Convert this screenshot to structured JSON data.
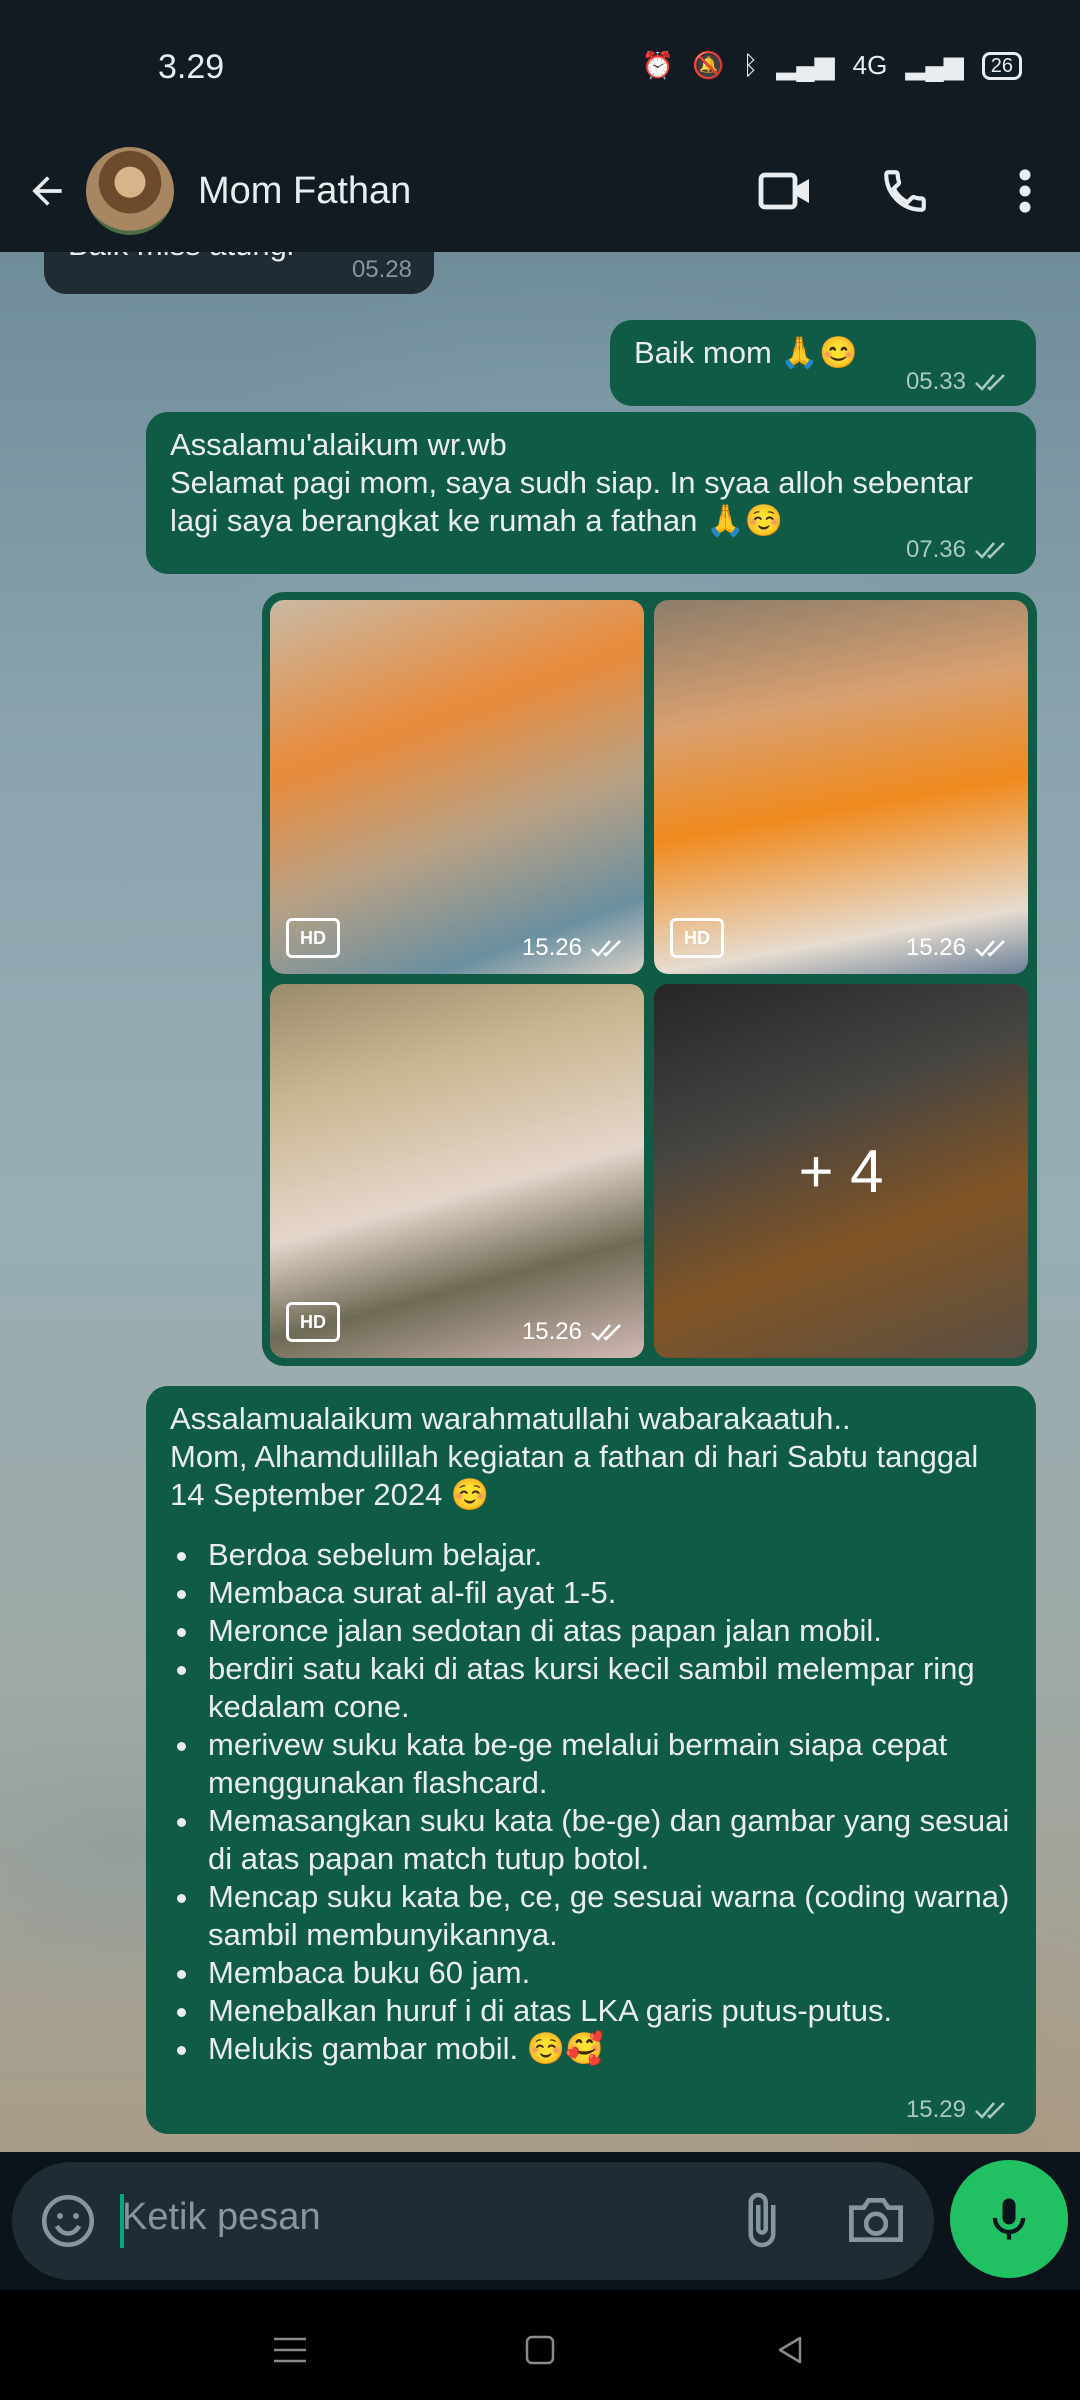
{
  "status_bar": {
    "time": "3.29",
    "battery": "26",
    "network": "4G"
  },
  "header": {
    "contact_name": "Mom Fathan",
    "icons": {
      "back": "back-arrow-icon",
      "video": "video-call-icon",
      "call": "phone-icon",
      "menu": "more-vert-icon"
    }
  },
  "messages": [
    {
      "id": "m0",
      "direction": "in",
      "text": "Baik miss atungi",
      "time": "05.28"
    },
    {
      "id": "m1",
      "direction": "out",
      "text": "Baik mom 🙏😊",
      "time": "05.33",
      "status": "read"
    },
    {
      "id": "m2",
      "direction": "out",
      "text": "Assalamu'alaikum wr.wb\nSelamat pagi mom, saya sudh siap. In syaa alloh sebentar lagi saya berangkat ke rumah a fathan 🙏☺️",
      "time": "07.36",
      "status": "read"
    }
  ],
  "media": {
    "tiles": [
      {
        "time": "15.26",
        "badge": "HD"
      },
      {
        "time": "15.26",
        "badge": "HD"
      },
      {
        "time": "15.26",
        "badge": "HD"
      },
      {
        "more": "+ 4"
      }
    ]
  },
  "report": {
    "intro": "Assalamualaikum warahmatullahi wabarakaatuh..\nMom, Alhamdulillah kegiatan a fathan di hari Sabtu tanggal 14 September 2024 ☺️",
    "items": [
      "Berdoa sebelum belajar.",
      "Membaca surat al-fil ayat 1-5.",
      "Meronce jalan sedotan di atas papan jalan mobil.",
      "berdiri satu kaki di atas kursi kecil sambil melempar ring kedalam cone.",
      "merivew suku kata be-ge melalui bermain siapa cepat menggunakan flashcard.",
      "Memasangkan suku kata (be-ge) dan gambar yang sesuai di atas papan match tutup botol.",
      "Mencap suku kata be, ce, ge sesuai warna (coding warna) sambil membunyikannya.",
      "Membaca buku 60 jam.",
      "Menebalkan huruf i di atas LKA garis putus-putus.",
      "Melukis gambar mobil. ☺️🥰"
    ],
    "time": "15.29",
    "status": "read"
  },
  "composer": {
    "placeholder": "Ketik pesan"
  },
  "colors": {
    "outgoing_bubble": "#0f5b46",
    "incoming_bubble": "#202c33",
    "accent": "#21c063"
  }
}
